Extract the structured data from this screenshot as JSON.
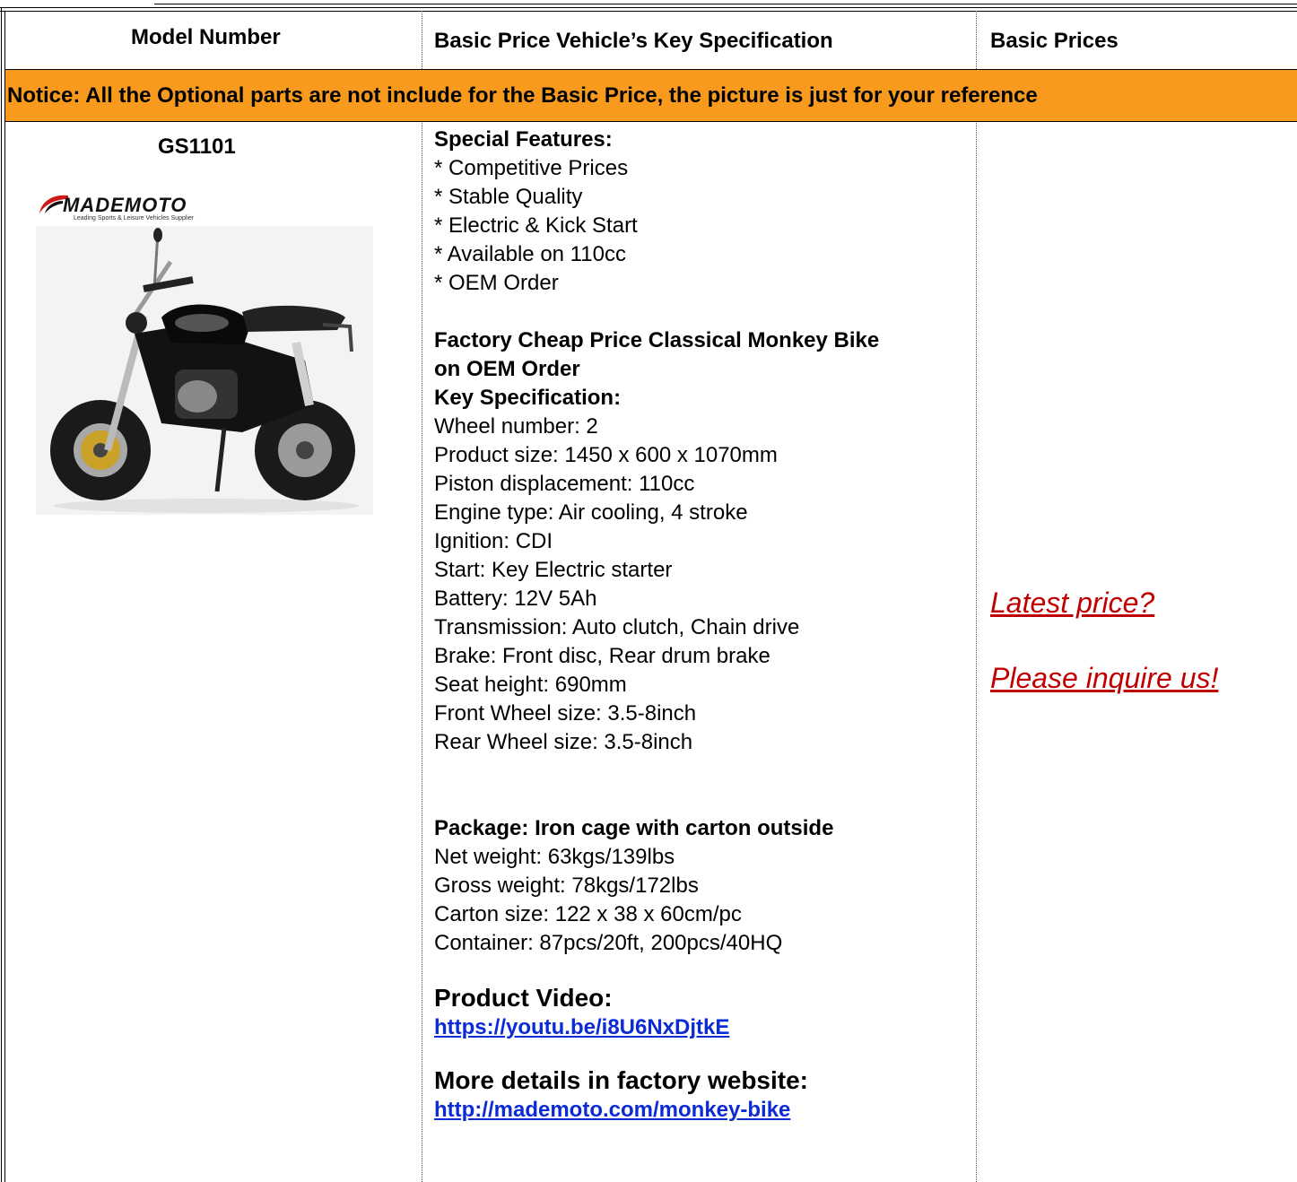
{
  "header": {
    "model_number": "Model Number",
    "key_spec": "Basic Price Vehicle’s Key Specification",
    "basic_prices": "Basic Prices"
  },
  "notice": "Notice: All the Optional parts are not include for the Basic Price, the picture is just for your reference",
  "product": {
    "model": "GS1101",
    "logo_name": "MADEMOTO",
    "logo_tagline": "Leading Sports & Leisure Vehicles Supplier",
    "special_features_title": "Special Features:",
    "special_features": [
      "* Competitive Prices",
      "* Stable Quality",
      "* Electric & Kick Start",
      "* Available on 110cc",
      "* OEM Order"
    ],
    "headline_line1": "Factory Cheap Price Classical Monkey Bike",
    "headline_line2": "on OEM Order",
    "key_spec_title": "Key Specification:",
    "key_specs": [
      "Wheel number: 2",
      "Product size: 1450 x 600 x 1070mm",
      "Piston displacement: 110cc",
      "Engine type: Air cooling, 4 stroke",
      "Ignition: CDI",
      "Start: Key Electric starter",
      "Battery: 12V 5Ah",
      "Transmission: Auto clutch, Chain drive",
      "Brake: Front disc, Rear drum brake",
      "Seat height: 690mm",
      "Front Wheel size: 3.5-8inch",
      "Rear Wheel size: 3.5-8inch"
    ],
    "package_title": "Package: Iron cage with carton outside",
    "package": [
      "Net weight: 63kgs/139lbs",
      "Gross weight: 78kgs/172lbs",
      "Carton size: 122 x 38 x 60cm/pc",
      "Container: 87pcs/20ft, 200pcs/40HQ"
    ],
    "video_title": "Product Video:",
    "video_url": "https://youtu.be/i8U6NxDjtkE",
    "website_title": "More details in factory website:",
    "website_url": "http://mademoto.com/monkey-bike",
    "price_line1": "Latest price? ",
    "price_line2": "Please inquire us!"
  },
  "colors": {
    "notice_bg": "#f79a1e",
    "price": "#c00000",
    "link": "#0b2bd4"
  }
}
